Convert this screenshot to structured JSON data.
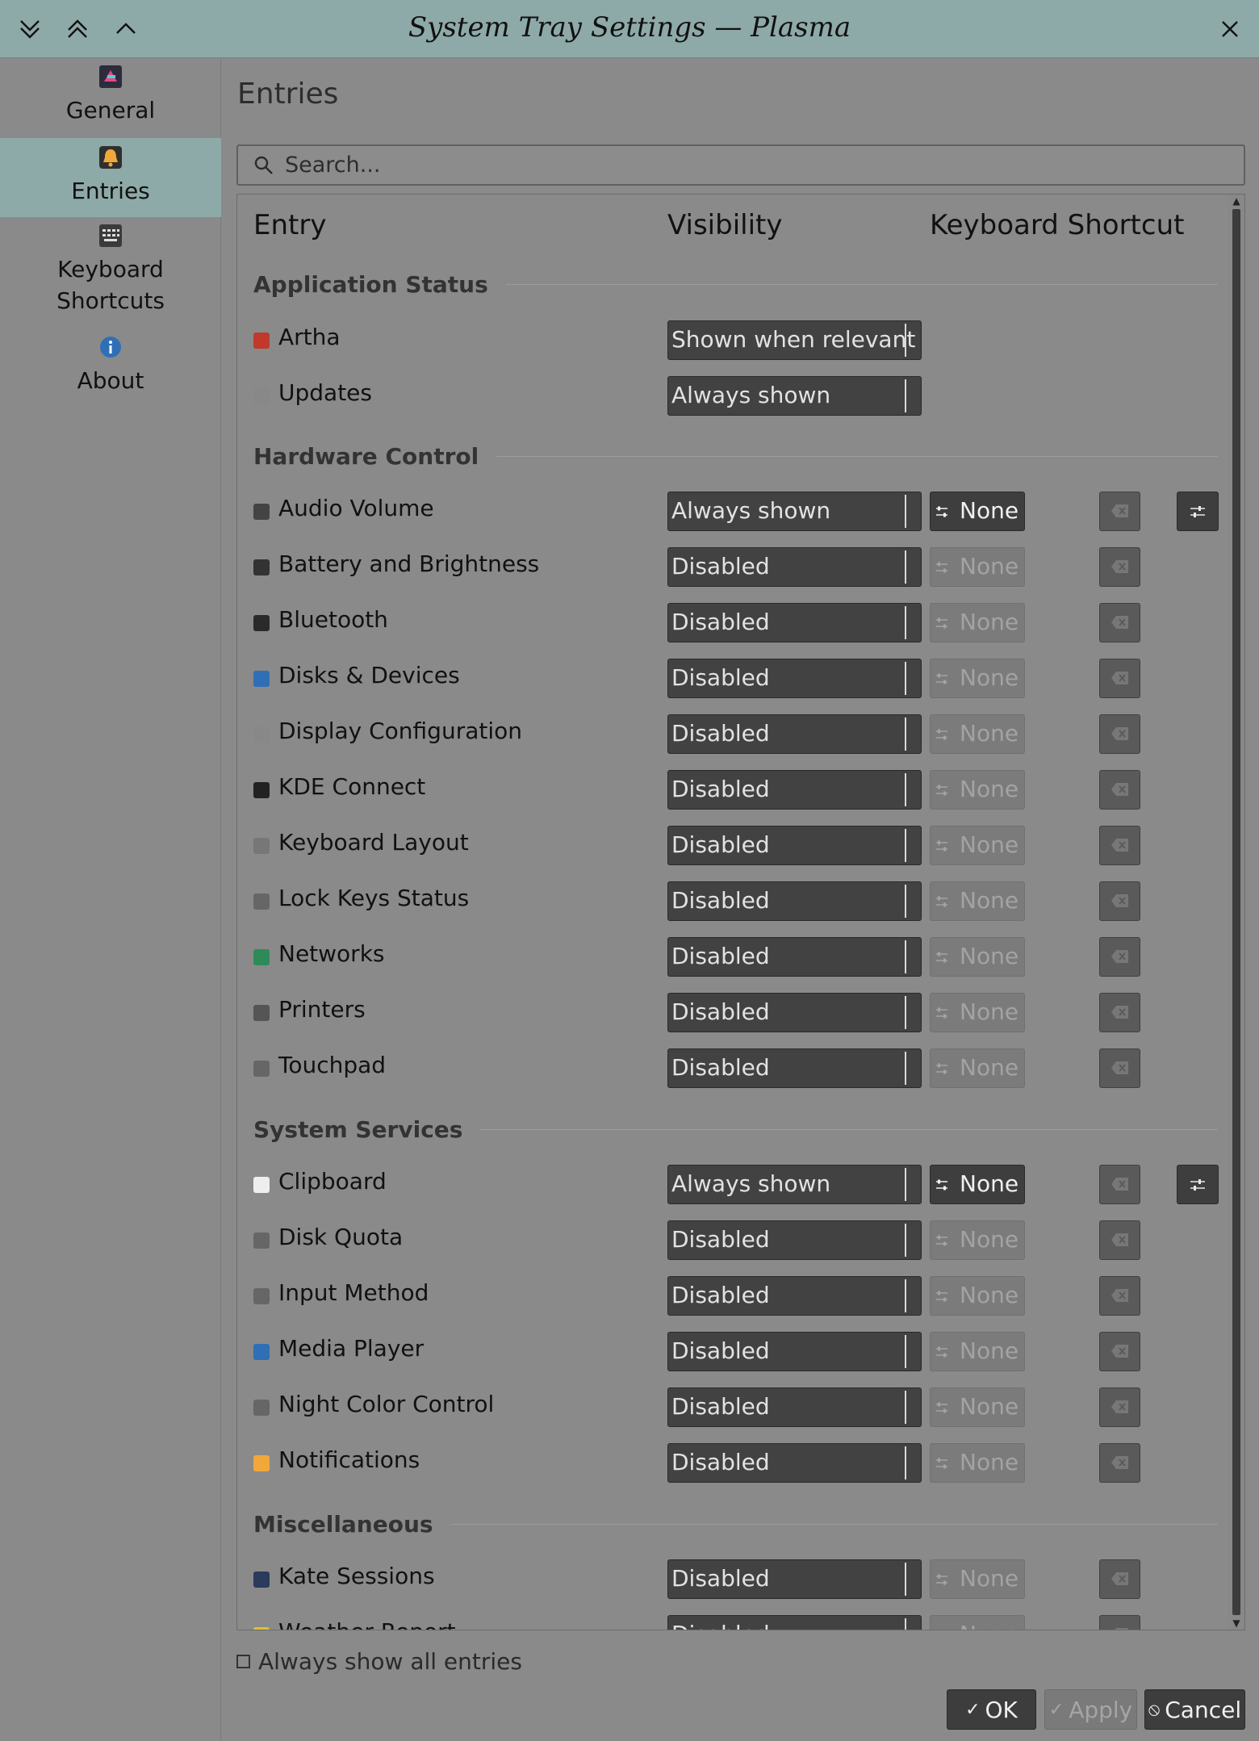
{
  "window": {
    "title": "System Tray Settings — Plasma",
    "buttons": [
      "chevrons-down-icon",
      "chevrons-up-icon",
      "chevron-up-icon",
      "close-icon"
    ]
  },
  "sidebar": {
    "items": [
      {
        "label": "General",
        "icon": "general-icon",
        "active": false
      },
      {
        "label": "Entries",
        "icon": "bell-icon",
        "active": true
      },
      {
        "label": "Keyboard\nShortcuts",
        "icon": "keyboard-icon",
        "active": false
      },
      {
        "label": "About",
        "icon": "info-icon",
        "active": false
      }
    ]
  },
  "main": {
    "title": "Entries",
    "search_placeholder": "Search...",
    "columns": {
      "entry": "Entry",
      "visibility": "Visibility",
      "shortcut": "Keyboard Shortcut"
    },
    "sections": {
      "app_status": "Application Status",
      "hardware": "Hardware Control",
      "system": "System Services",
      "misc": "Miscellaneous"
    },
    "rows": [
      {
        "name": "Artha",
        "visibility": "Shown when relevant",
        "icon": "artha-icon"
      },
      {
        "name": "Updates",
        "visibility": "Always shown",
        "icon": "updates-icon"
      },
      {
        "name": "Audio Volume",
        "visibility": "Always shown",
        "shortcut": "None",
        "icon": "speaker-icon"
      },
      {
        "name": "Battery and Brightness",
        "visibility": "Disabled",
        "shortcut": "None",
        "icon": "battery-icon"
      },
      {
        "name": "Bluetooth",
        "visibility": "Disabled",
        "shortcut": "None",
        "icon": "bluetooth-icon"
      },
      {
        "name": "Disks & Devices",
        "visibility": "Disabled",
        "shortcut": "None",
        "icon": "disk-icon"
      },
      {
        "name": "Display Configuration",
        "visibility": "Disabled",
        "shortcut": "None",
        "icon": "display-icon"
      },
      {
        "name": "KDE Connect",
        "visibility": "Disabled",
        "shortcut": "None",
        "icon": "kdeconnect-icon"
      },
      {
        "name": "Keyboard Layout",
        "visibility": "Disabled",
        "shortcut": "None",
        "icon": "keyboard-layout-icon"
      },
      {
        "name": "Lock Keys Status",
        "visibility": "Disabled",
        "shortcut": "None",
        "icon": "lock-keys-icon"
      },
      {
        "name": "Networks",
        "visibility": "Disabled",
        "shortcut": "None",
        "icon": "network-icon"
      },
      {
        "name": "Printers",
        "visibility": "Disabled",
        "shortcut": "None",
        "icon": "printer-icon"
      },
      {
        "name": "Touchpad",
        "visibility": "Disabled",
        "shortcut": "None",
        "icon": "touchpad-icon"
      },
      {
        "name": "Clipboard",
        "visibility": "Always shown",
        "shortcut": "None",
        "icon": "clipboard-icon"
      },
      {
        "name": "Disk Quota",
        "visibility": "Disabled",
        "shortcut": "None",
        "icon": "disk-quota-icon"
      },
      {
        "name": "Input Method",
        "visibility": "Disabled",
        "shortcut": "None",
        "icon": "input-method-icon"
      },
      {
        "name": "Media Player",
        "visibility": "Disabled",
        "shortcut": "None",
        "icon": "media-player-icon"
      },
      {
        "name": "Night Color Control",
        "visibility": "Disabled",
        "shortcut": "None",
        "icon": "night-color-icon"
      },
      {
        "name": "Notifications",
        "visibility": "Disabled",
        "shortcut": "None",
        "icon": "notifications-icon"
      },
      {
        "name": "Kate Sessions",
        "visibility": "Disabled",
        "shortcut": "None",
        "icon": "kate-icon"
      },
      {
        "name": "Weather Report",
        "visibility": "Disabled",
        "shortcut": "None",
        "icon": "weather-icon"
      }
    ],
    "always_show_all": "Always show all entries"
  },
  "footer": {
    "ok": "OK",
    "apply": "Apply",
    "cancel": "Cancel"
  },
  "colors": {
    "accent": "#8eaaa8",
    "background": "#8a8a8a",
    "control": "#424242"
  }
}
